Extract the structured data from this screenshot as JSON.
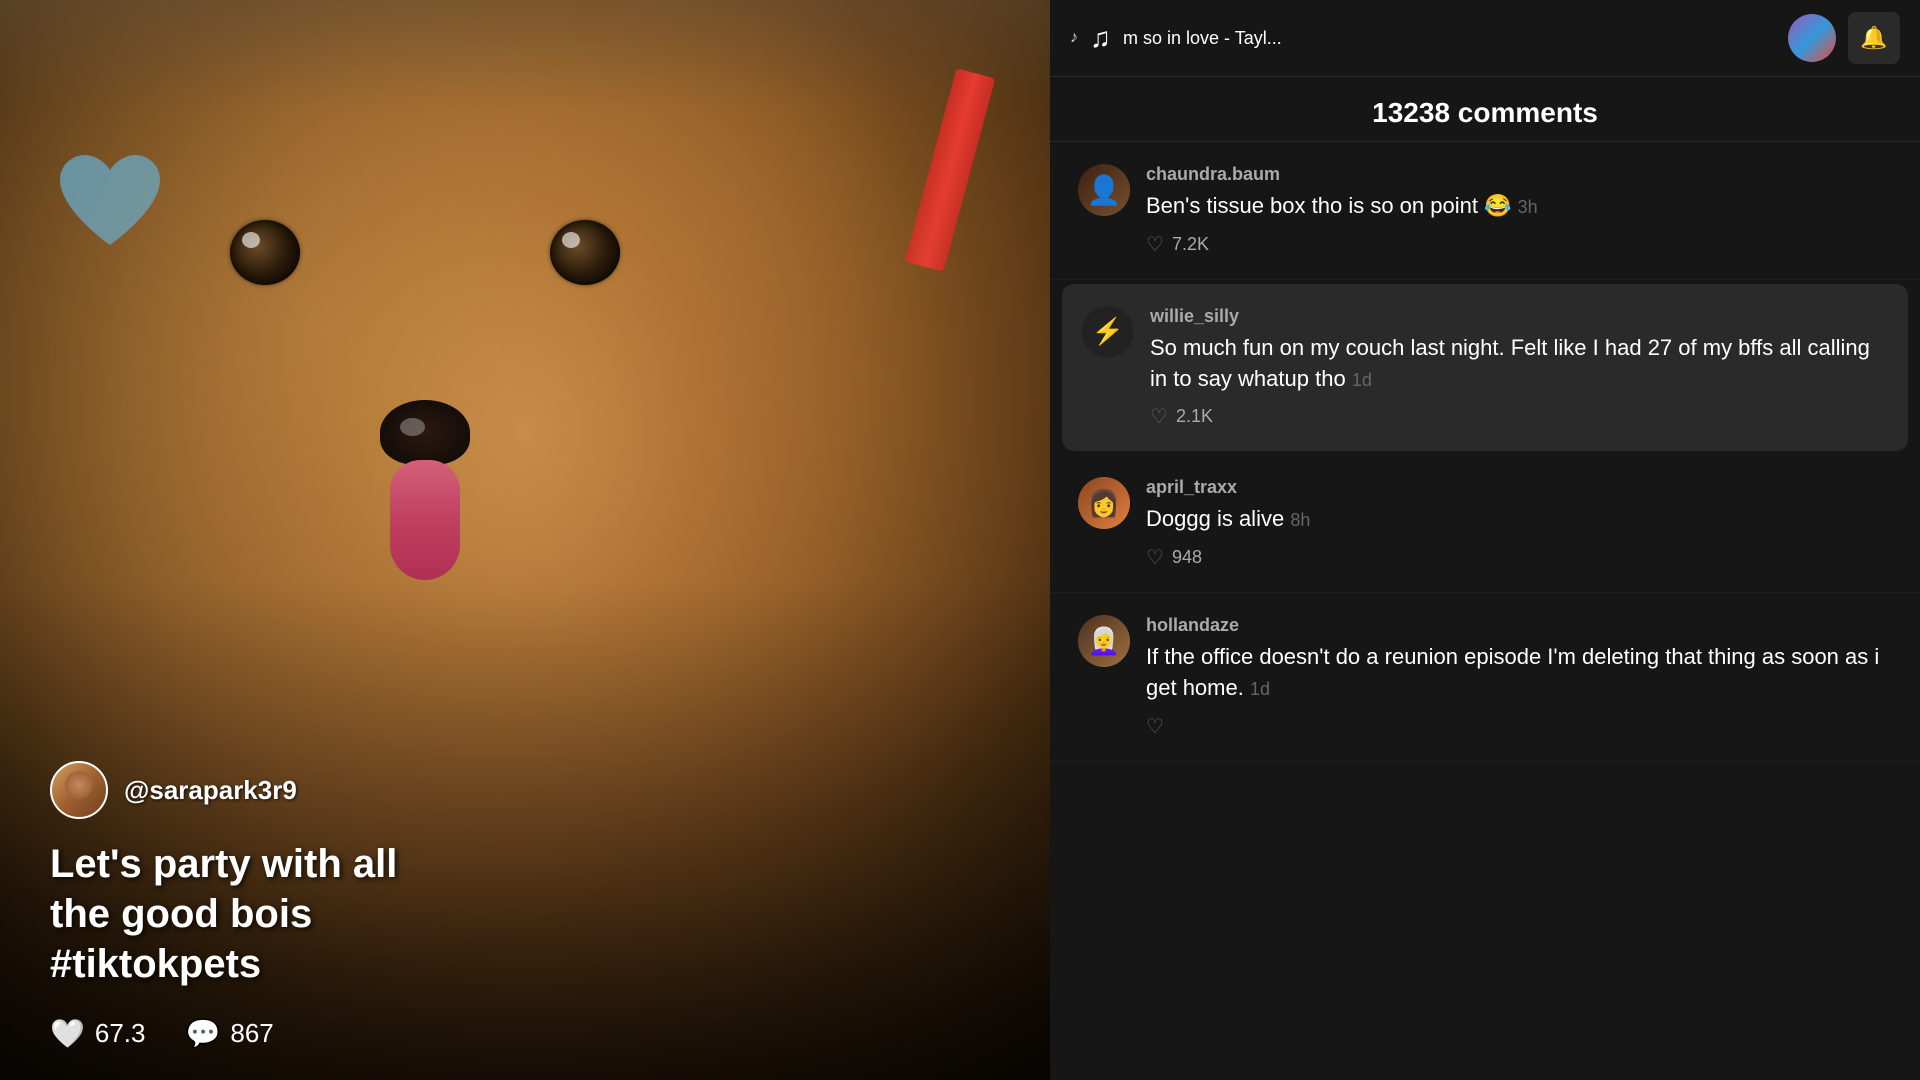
{
  "video": {
    "author": "@sarapark3r9",
    "caption": "Let's party with all\nthe good bois\n#tiktokpets",
    "likes": "67.3",
    "comments": "867",
    "likes_label": "67.3",
    "comments_label": "867"
  },
  "music": {
    "text": "m so in love - Tayl...",
    "note_icon": "♪",
    "note_spin_icon": "♫"
  },
  "comments": {
    "count": "13238 comments",
    "items": [
      {
        "username": "chaundra.baum",
        "text": "Ben's tissue box tho is so on point 😂",
        "time": "3h",
        "likes": "7.2K",
        "highlighted": false,
        "avatar_emoji": "🧑‍🦱"
      },
      {
        "username": "willie_silly",
        "text": "So much fun on my couch last night. Felt like I had 27 of my bffs all calling in to say whatup tho",
        "time": "1d",
        "likes": "2.1K",
        "highlighted": true,
        "avatar_emoji": "⚡"
      },
      {
        "username": "april_traxx",
        "text": "Doggg is alive",
        "time": "8h",
        "likes": "948",
        "highlighted": false,
        "avatar_emoji": "👩"
      },
      {
        "username": "hollandaze",
        "text": "If the office doesn't do a reunion episode I'm deleting that thing as soon as i get home.",
        "time": "1d",
        "likes": "",
        "highlighted": false,
        "avatar_emoji": "👩‍🦳"
      }
    ]
  },
  "buttons": {
    "notification_icon": "🔔",
    "like_icon": "♡",
    "comment_icon": "💬"
  }
}
